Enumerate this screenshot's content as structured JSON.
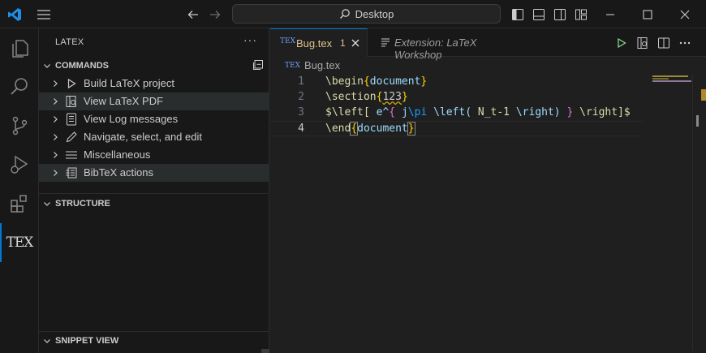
{
  "titlebar": {
    "search_text": "Desktop"
  },
  "activity": {
    "tex_label": "TEX"
  },
  "sidebar": {
    "title": "LATEX",
    "more": "···",
    "commands_header": "COMMANDS",
    "structure_header": "STRUCTURE",
    "snippet_header": "SNIPPET VIEW",
    "commands": [
      {
        "label": "Build LaTeX project"
      },
      {
        "label": "View LaTeX PDF"
      },
      {
        "label": "View Log messages"
      },
      {
        "label": "Navigate, select, and edit"
      },
      {
        "label": "Miscellaneous"
      },
      {
        "label": "BibTeX actions"
      }
    ]
  },
  "editor": {
    "tabs": [
      {
        "label": "Bug.tex",
        "badge": "1",
        "icon_text": "TEX"
      },
      {
        "label": "Extension: LaTeX Workshop"
      }
    ],
    "breadcrumb": "Bug.tex",
    "breadcrumb_icon": "TEX",
    "line_numbers": [
      "1",
      "2",
      "3",
      "4"
    ]
  },
  "colors": {
    "accent": "#0078d4",
    "background": "#1f1f1f",
    "sidebar": "#181818",
    "tab_active_text": "#e2c08d"
  }
}
